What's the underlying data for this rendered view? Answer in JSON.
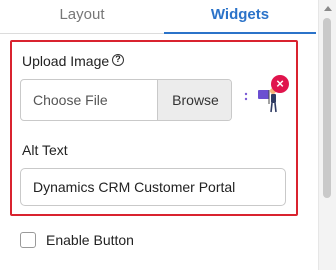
{
  "tabs": {
    "layout": "Layout",
    "widgets": "Widgets",
    "active": "Widgets"
  },
  "upload": {
    "label": "Upload Image",
    "help_icon": "question-circle-icon",
    "help_glyph": "?",
    "file_placeholder": "Choose File",
    "browse_label": "Browse",
    "remove_icon": "close-icon",
    "remove_glyph": "×",
    "preview_icon": "image-illustration-icon"
  },
  "alt_text": {
    "label": "Alt Text",
    "value": "Dynamics CRM Customer Portal"
  },
  "enable_button": {
    "label": "Enable Button",
    "checked": false
  },
  "colors": {
    "accent": "#2b73c9",
    "highlight_border": "#d9232f",
    "remove_badge": "#e0144c"
  }
}
